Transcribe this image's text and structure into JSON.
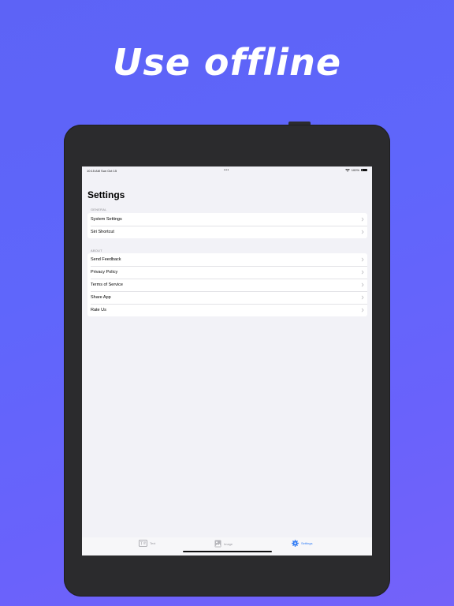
{
  "headline": "Use offline",
  "status_bar": {
    "time": "10:15 AM",
    "date": "Sun Oct 15",
    "dots": "•••",
    "battery": "100%"
  },
  "page": {
    "title": "Settings"
  },
  "sections": [
    {
      "header": "GENERAL",
      "items": [
        {
          "label": "System Settings"
        },
        {
          "label": "Siri Shortcut"
        }
      ]
    },
    {
      "header": "ABOUT",
      "items": [
        {
          "label": "Send Feedback"
        },
        {
          "label": "Privacy Policy"
        },
        {
          "label": "Terms of Service"
        },
        {
          "label": "Share App"
        },
        {
          "label": "Rate Us"
        }
      ]
    }
  ],
  "tab_bar": {
    "tabs": [
      {
        "label": "Text",
        "icon": "text-scan-icon",
        "active": false
      },
      {
        "label": "Image",
        "icon": "image-icon",
        "active": false
      },
      {
        "label": "Settings",
        "icon": "gear-icon",
        "active": true
      }
    ]
  },
  "colors": {
    "background_gradient_start": "#5d63f6",
    "background_gradient_end": "#7462f9",
    "accent": "#2f7bf5",
    "device_frame": "#2b2b2d",
    "screen_background": "#f2f2f7"
  }
}
